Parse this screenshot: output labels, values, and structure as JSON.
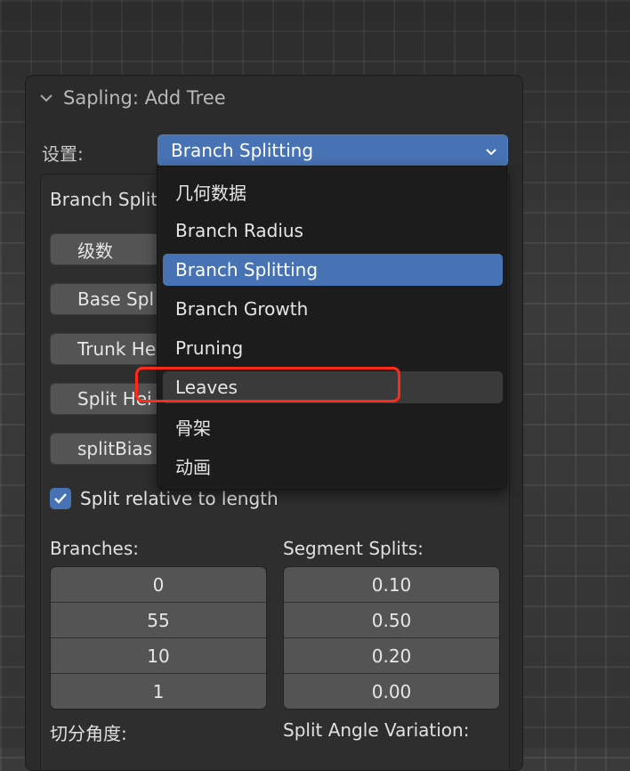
{
  "panel": {
    "title": "Sapling: Add Tree",
    "settings_label": "设置:",
    "selected_setting": "Branch Splitting"
  },
  "subpanel": {
    "title": "Branch Split",
    "buttons": [
      "级数",
      "Base Spl",
      "Trunk He",
      "Split Hei",
      "splitBias"
    ],
    "checkbox": {
      "label": "Split relative to length",
      "checked": true
    },
    "branches": {
      "label": "Branches:",
      "values": [
        "0",
        "55",
        "10",
        "1"
      ]
    },
    "segment_splits": {
      "label": "Segment Splits:",
      "values": [
        "0.10",
        "0.50",
        "0.20",
        "0.00"
      ]
    },
    "bottom_left_label": "切分角度:",
    "bottom_right_label": "Split Angle Variation:"
  },
  "dropdown": {
    "items": [
      "几何数据",
      "Branch Radius",
      "Branch Splitting",
      "Branch Growth",
      "Pruning",
      "Leaves",
      "骨架",
      "动画"
    ],
    "selected_index": 2,
    "hovered_index": 5
  },
  "colors": {
    "accent": "#4772b3",
    "highlight_outline": "#ff2a1a",
    "panel_bg": "#2b2b2b",
    "field_bg": "#545454"
  },
  "icons": {
    "collapse": "chevron-down-icon",
    "dropdown_arrow": "chevron-down-icon",
    "check": "check-icon"
  }
}
